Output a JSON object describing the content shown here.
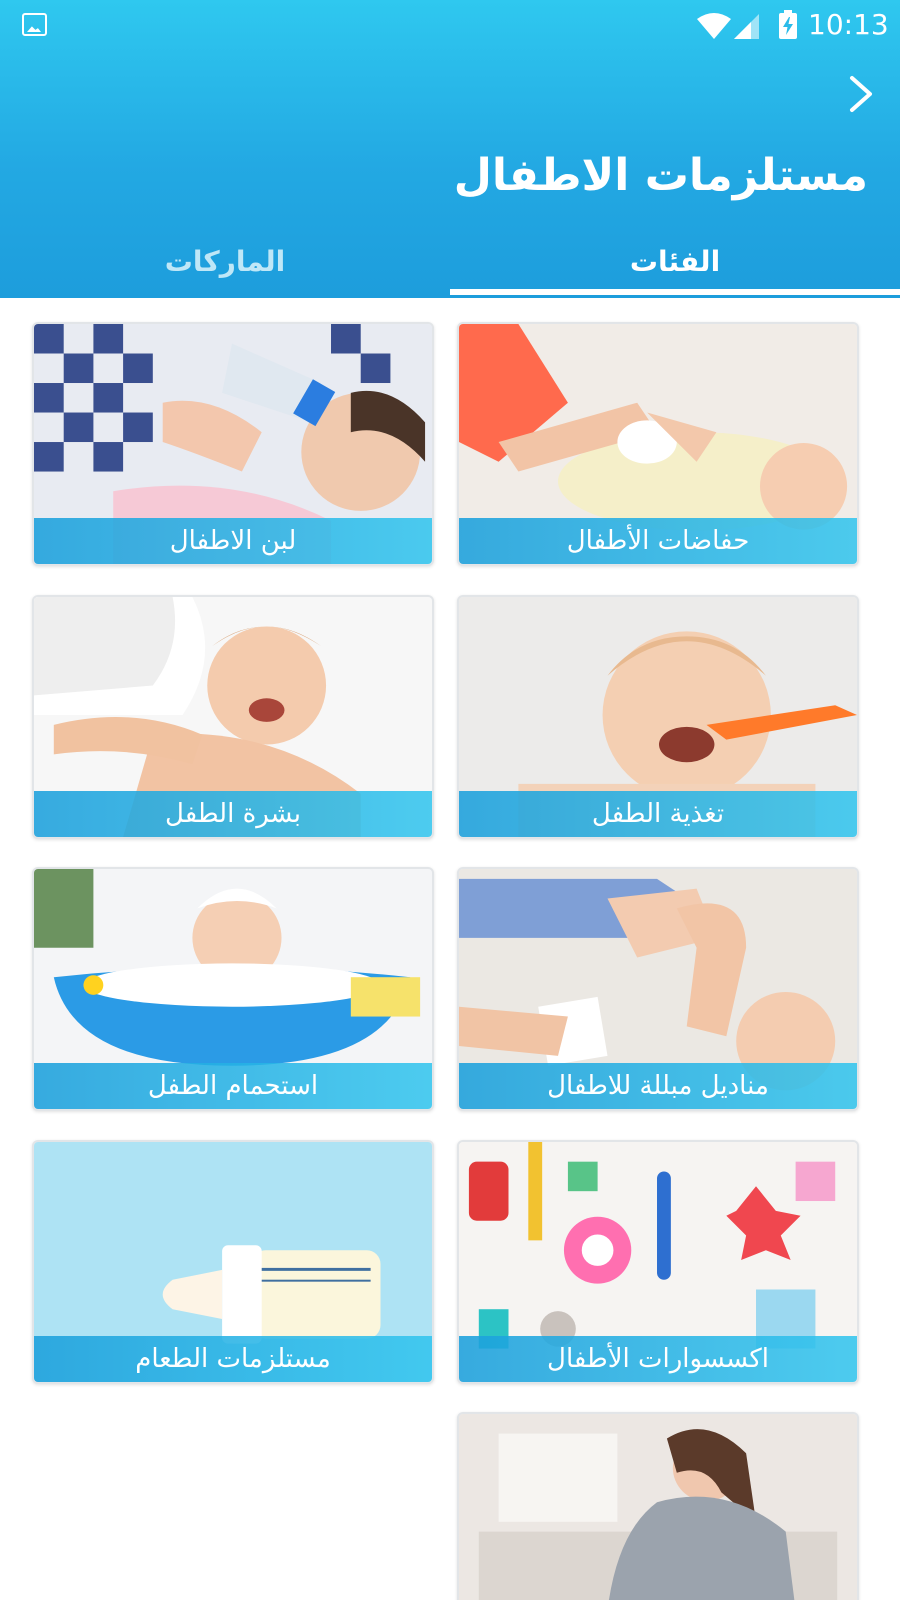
{
  "status_bar": {
    "time": "10:13",
    "icons": [
      "image-notification-icon",
      "wifi-icon",
      "signal-icon",
      "battery-charging-icon"
    ]
  },
  "header": {
    "title": "مستلزمات الاطفال",
    "back_icon": "chevron-right-icon"
  },
  "tabs": [
    {
      "label": "الفئات",
      "selected": true
    },
    {
      "label": "الماركات",
      "selected": false
    }
  ],
  "categories": [
    {
      "label": "حفاضات الأطفال",
      "image": "baby-diaper-change-photo"
    },
    {
      "label": "لبن الاطفال",
      "image": "baby-bottle-feeding-photo"
    },
    {
      "label": "تغذية الطفل",
      "image": "baby-spoon-feeding-photo"
    },
    {
      "label": "بشرة الطفل",
      "image": "baby-skin-massage-photo"
    },
    {
      "label": "مناديل مبللة للاطفال",
      "image": "baby-wipes-photo"
    },
    {
      "label": "استحمام الطفل",
      "image": "baby-bath-tub-photo"
    },
    {
      "label": "اكسسوارات الأطفال",
      "image": "baby-accessories-toys-photo"
    },
    {
      "label": "مستلزمات الطعام",
      "image": "milk-bottle-photo"
    },
    {
      "label": "",
      "image": "pregnant-woman-photo"
    }
  ],
  "colors": {
    "header_top": "#2fc8ef",
    "header_bottom": "#1d9ddc",
    "label_bar": "#25b4e8",
    "inactive_tab": "#bfe7f7"
  }
}
